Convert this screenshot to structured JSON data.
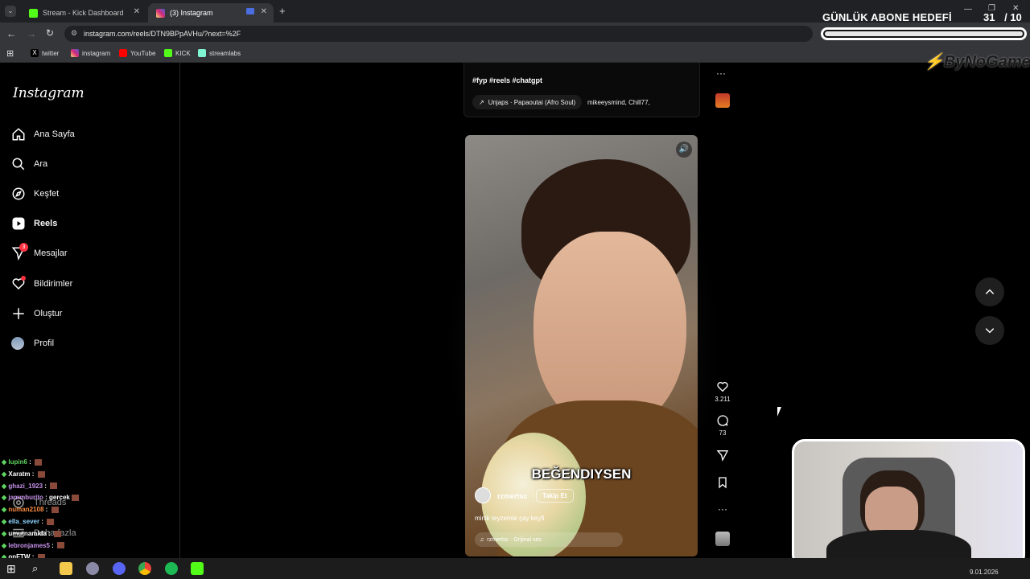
{
  "browser": {
    "tabs": [
      {
        "label": "Stream - Kick Dashboard",
        "color": "#53fc18"
      },
      {
        "label": "(3) Instagram",
        "color": "#e1306c"
      }
    ],
    "url": "instagram.com/reels/DTN9BPpAVHu/?next=%2F",
    "bookmarks": [
      {
        "label": "twitter",
        "icon": "x-icon"
      },
      {
        "label": "instagram",
        "icon": "instagram-icon"
      },
      {
        "label": "YouTube",
        "icon": "youtube-icon"
      },
      {
        "label": "KICK",
        "icon": "kick-icon"
      },
      {
        "label": "streamlabs",
        "icon": "streamlabs-icon"
      }
    ]
  },
  "overlay": {
    "title": "GÜNLÜK ABONE HEDEFİ",
    "current": "31",
    "target": "/ 10",
    "progress": 1.0,
    "logo": "ByNoGame"
  },
  "sidebar": {
    "logo": "Instagram",
    "items": [
      {
        "label": "Ana Sayfa",
        "icon": "home-icon"
      },
      {
        "label": "Ara",
        "icon": "search-icon"
      },
      {
        "label": "Keşfet",
        "icon": "compass-icon"
      },
      {
        "label": "Reels",
        "icon": "reels-icon"
      },
      {
        "label": "Mesajlar",
        "icon": "messenger-icon",
        "badge": "3"
      },
      {
        "label": "Bildirimler",
        "icon": "heart-icon"
      },
      {
        "label": "Oluştur",
        "icon": "plus-icon"
      },
      {
        "label": "Profil",
        "icon": "avatar-icon"
      }
    ],
    "threads": "Threads",
    "more": "Daha fazla"
  },
  "prev_post": {
    "caption": "#fyp #reels #chatgpt",
    "audio": "Unjaps · Papaoutai (Afro Soul)",
    "users": "mikeeysmind, Chill77,"
  },
  "reel": {
    "overlay_text": "BEĞENDIYSEN",
    "username": "rzmertsc",
    "follow": "Takip Et",
    "caption": "minik teyzemle çay keyfi",
    "audio": "rzmertsc · Orijinal ses",
    "likes": "3.211",
    "comments": "73"
  },
  "chat": [
    {
      "user": "lupin6",
      "msg": "",
      "color": "#5fd35f"
    },
    {
      "user": "Xaratm",
      "msg": "",
      "color": "#ffffff"
    },
    {
      "user": "ghazi_1923",
      "msg": "",
      "color": "#c792ea"
    },
    {
      "user": "jammburito",
      "msg": "gercek",
      "color": "#c792ea"
    },
    {
      "user": "numan2108",
      "msg": "",
      "color": "#ff8c42"
    },
    {
      "user": "ella_sever",
      "msg": "",
      "color": "#8fd3ff"
    },
    {
      "user": "umutnamida",
      "msg": "",
      "color": "#ffffff"
    },
    {
      "user": "lebronjames5",
      "msg": "",
      "color": "#c792ea"
    },
    {
      "user": "onFTW",
      "msg": "",
      "color": "#ffffff"
    }
  ],
  "taskbar": {
    "date": "9.01.2026"
  }
}
